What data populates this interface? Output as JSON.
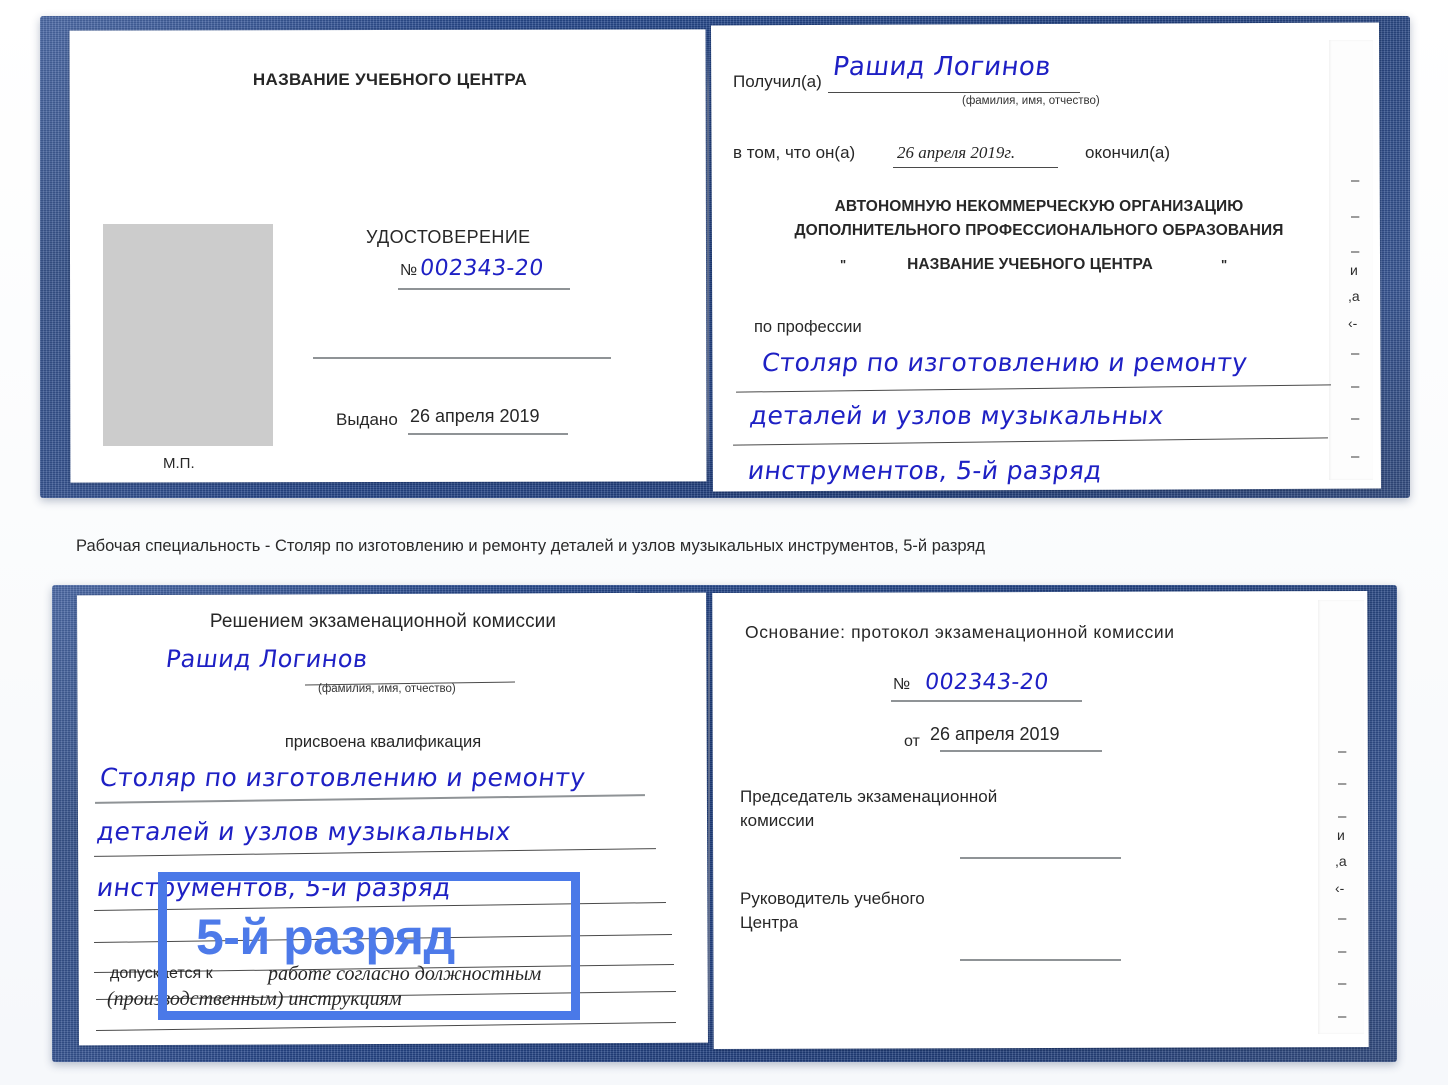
{
  "caption": {
    "text": "Рабочая специальность - Столяр по изготовлению и ремонту деталей и узлов музыкальных инструментов, 5-й разряд"
  },
  "callout": {
    "label": "5-й разряд",
    "box_color": "#4a79e8",
    "text_color": "#4d7ae9"
  },
  "colors": {
    "cover_blue": "#24447f",
    "handwriting_blue": "#1e20c4",
    "paper_white": "#ffffff",
    "photo_placeholder_gray": "#cccccc",
    "rule_gray": "#8f9396"
  },
  "certificate_top": {
    "left_page": {
      "org_title": "НАЗВАНИЕ УЧЕБНОГО ЦЕНТРА",
      "doc_type": "УДОСТОВЕРЕНИЕ",
      "number_symbol": "№",
      "number_value": "002343-20",
      "issued_label": "Выдано",
      "issued_date": "26 апреля 2019",
      "seal_label": "М.П.",
      "photo_placeholder": "photo-area"
    },
    "right_page": {
      "received_label": "Получил(а)",
      "received_name": "Рашид Логинов",
      "fio_hint": "(фамилия, имя, отчество)",
      "in_that_label": "в том, что он(а)",
      "completion_date": "26 апреля 2019г.",
      "finished_label": "окончил(а)",
      "org_line1": "АВТОНОМНУЮ НЕКОММЕРЧЕСКУЮ ОРГАНИЗАЦИЮ",
      "org_line2": "ДОПОЛНИТЕЛЬНОГО ПРОФЕССИОНАЛЬНОГО ОБРАЗОВАНИЯ",
      "org_quote_open": "\"",
      "org_line3": "НАЗВАНИЕ УЧЕБНОГО ЦЕНТРА",
      "org_quote_close": "\"",
      "profession_label": "по профессии",
      "profession_line1": "Столяр по изготовлению и ремонту",
      "profession_line2": "деталей и узлов музыкальных",
      "profession_line3": "инструментов, 5-й разряд",
      "edge_fragments": [
        "–",
        "–",
        "–",
        "и",
        ",а",
        "‹-",
        "–",
        "–",
        "–",
        "–"
      ]
    }
  },
  "certificate_bottom": {
    "left_page": {
      "heading": "Решением экзаменационной комиссии",
      "name": "Рашид Логинов",
      "fio_hint": "(фамилия, имя, отчество)",
      "qualification_label": "присвоена квалификация",
      "qualification_line1": "Столяр по изготовлению и ремонту",
      "qualification_line2": "деталей и узлов музыкальных",
      "qualification_line3": "инструментов, 5-й разряд",
      "admitted_label": "допускается к",
      "admitted_line1": "работе согласно должностным",
      "admitted_line2": "(производственным) инструкциям"
    },
    "right_page": {
      "basis_label": "Основание: протокол экзаменационной комиссии",
      "number_symbol": "№",
      "number_value": "002343-20",
      "date_prefix": "от",
      "date_value": "26 апреля 2019",
      "chairman_line1": "Председатель экзаменационной",
      "chairman_line2": "комиссии",
      "head_line1": "Руководитель учебного",
      "head_line2": "Центра",
      "edge_fragments": [
        "–",
        "–",
        "–",
        "и",
        ",а",
        "‹-",
        "–",
        "–",
        "–",
        "–"
      ]
    }
  }
}
